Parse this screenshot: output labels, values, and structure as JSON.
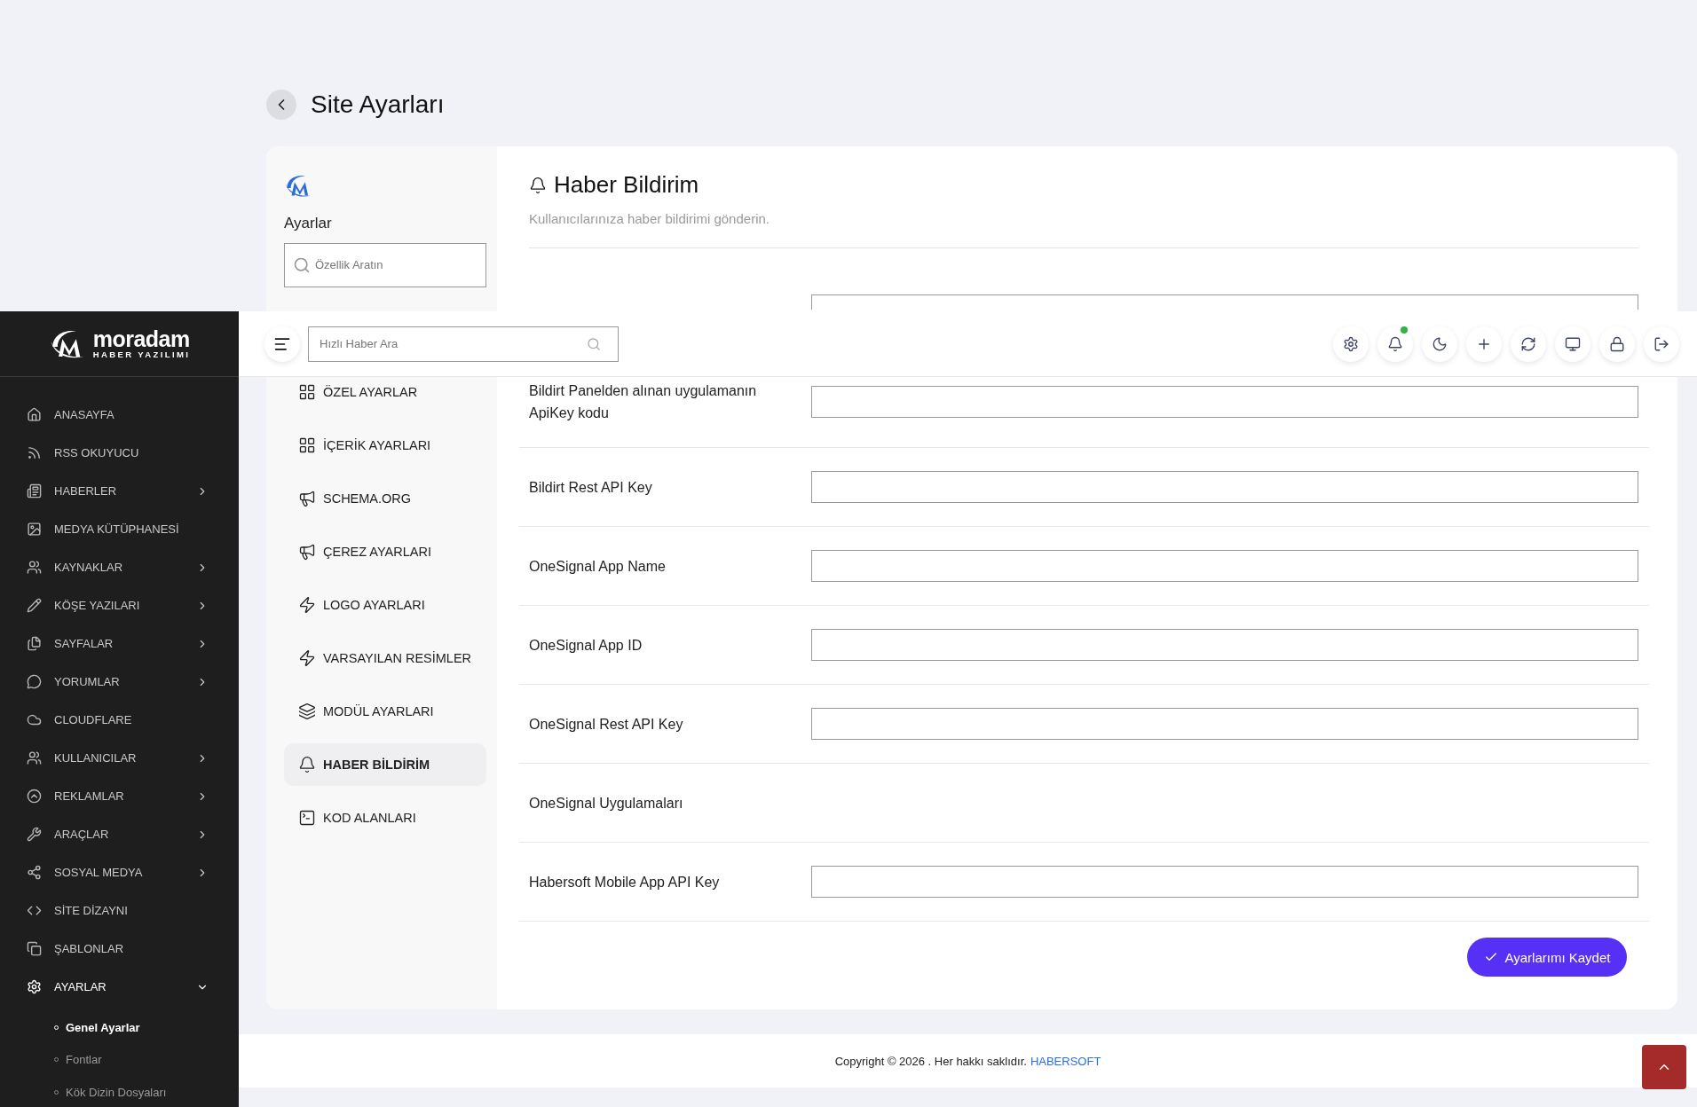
{
  "page": {
    "title": "Site Ayarları"
  },
  "settings_nav": {
    "title": "Ayarlar",
    "search": {
      "placeholder": "Özellik Aratın"
    },
    "items": [
      {
        "label": "ÖZEL AYARLAR",
        "selected": false
      },
      {
        "label": "İÇERİK AYARLARI",
        "selected": false
      },
      {
        "label": "SCHEMA.ORG",
        "selected": false
      },
      {
        "label": "ÇEREZ AYARLARI",
        "selected": false
      },
      {
        "label": "LOGO AYARLARI",
        "selected": false
      },
      {
        "label": "VARSAYILAN RESİMLER",
        "selected": false
      },
      {
        "label": "MODÜL AYARLARI",
        "selected": false
      },
      {
        "label": "HABER BİLDİRİM",
        "selected": true
      },
      {
        "label": "KOD ALANLARI",
        "selected": false
      }
    ]
  },
  "section": {
    "title": "Haber Bildirim",
    "subtitle": "Kullanıcılarınıza haber bildirimi gönderin."
  },
  "fields": [
    {
      "kind": "input_cut"
    },
    {
      "label": "Bildirt Panelden alınan uygulamanın ApiKey kodu",
      "kind": "input"
    },
    {
      "label": "Bildirt Rest API Key",
      "kind": "input"
    },
    {
      "label": "OneSignal App Name",
      "kind": "input"
    },
    {
      "label": "OneSignal App ID",
      "kind": "input"
    },
    {
      "label": "OneSignal Rest API Key",
      "kind": "input"
    },
    {
      "label": "OneSignal Uygulamaları",
      "kind": "text"
    },
    {
      "label": "Habersoft Mobile App API Key",
      "kind": "input"
    }
  ],
  "save_button": "Ayarlarımı Kaydet",
  "sidebar": {
    "logo": {
      "name": "moradam",
      "tagline": "HABER YAZILIMI"
    },
    "items": [
      {
        "label": "ANASAYFA",
        "kind": "link",
        "selected": false
      },
      {
        "label": "RSS OKUYUCU",
        "kind": "link",
        "selected": false
      },
      {
        "label": "HABERLER",
        "kind": "group",
        "expanded": false,
        "selected": false
      },
      {
        "label": "MEDYA KÜTÜPHANESİ",
        "kind": "link",
        "selected": false
      },
      {
        "label": "KAYNAKLAR",
        "kind": "group",
        "expanded": false,
        "selected": false
      },
      {
        "label": "KÖŞE YAZILARI",
        "kind": "group",
        "expanded": false,
        "selected": false
      },
      {
        "label": "SAYFALAR",
        "kind": "group",
        "expanded": false,
        "selected": false
      },
      {
        "label": "YORUMLAR",
        "kind": "group",
        "expanded": false,
        "selected": false
      },
      {
        "label": "CLOUDFLARE",
        "kind": "link",
        "selected": false
      },
      {
        "label": "KULLANICILAR",
        "kind": "group",
        "expanded": false,
        "selected": false
      },
      {
        "label": "REKLAMLAR",
        "kind": "group",
        "expanded": false,
        "selected": false
      },
      {
        "label": "ARAÇLAR",
        "kind": "group",
        "expanded": false,
        "selected": false
      },
      {
        "label": "SOSYAL MEDYA",
        "kind": "group",
        "expanded": false,
        "selected": false
      },
      {
        "label": "SİTE DİZAYNI",
        "kind": "link",
        "selected": false
      },
      {
        "label": "ŞABLONLAR",
        "kind": "link",
        "selected": false
      },
      {
        "label": "AYARLAR",
        "kind": "group",
        "expanded": true,
        "selected": true,
        "children": [
          {
            "label": "Genel Ayarlar",
            "selected": true
          },
          {
            "label": "Fontlar",
            "selected": false
          },
          {
            "label": "Kök Dizin Dosyaları",
            "selected": false
          }
        ]
      }
    ]
  },
  "topbar": {
    "search": {
      "placeholder": "Hızlı Haber Ara"
    },
    "notification_badge": true
  },
  "footer": {
    "copyright": "Copyright © 2026 . Her hakkı saklıdır.",
    "link": "HABERSOFT"
  }
}
